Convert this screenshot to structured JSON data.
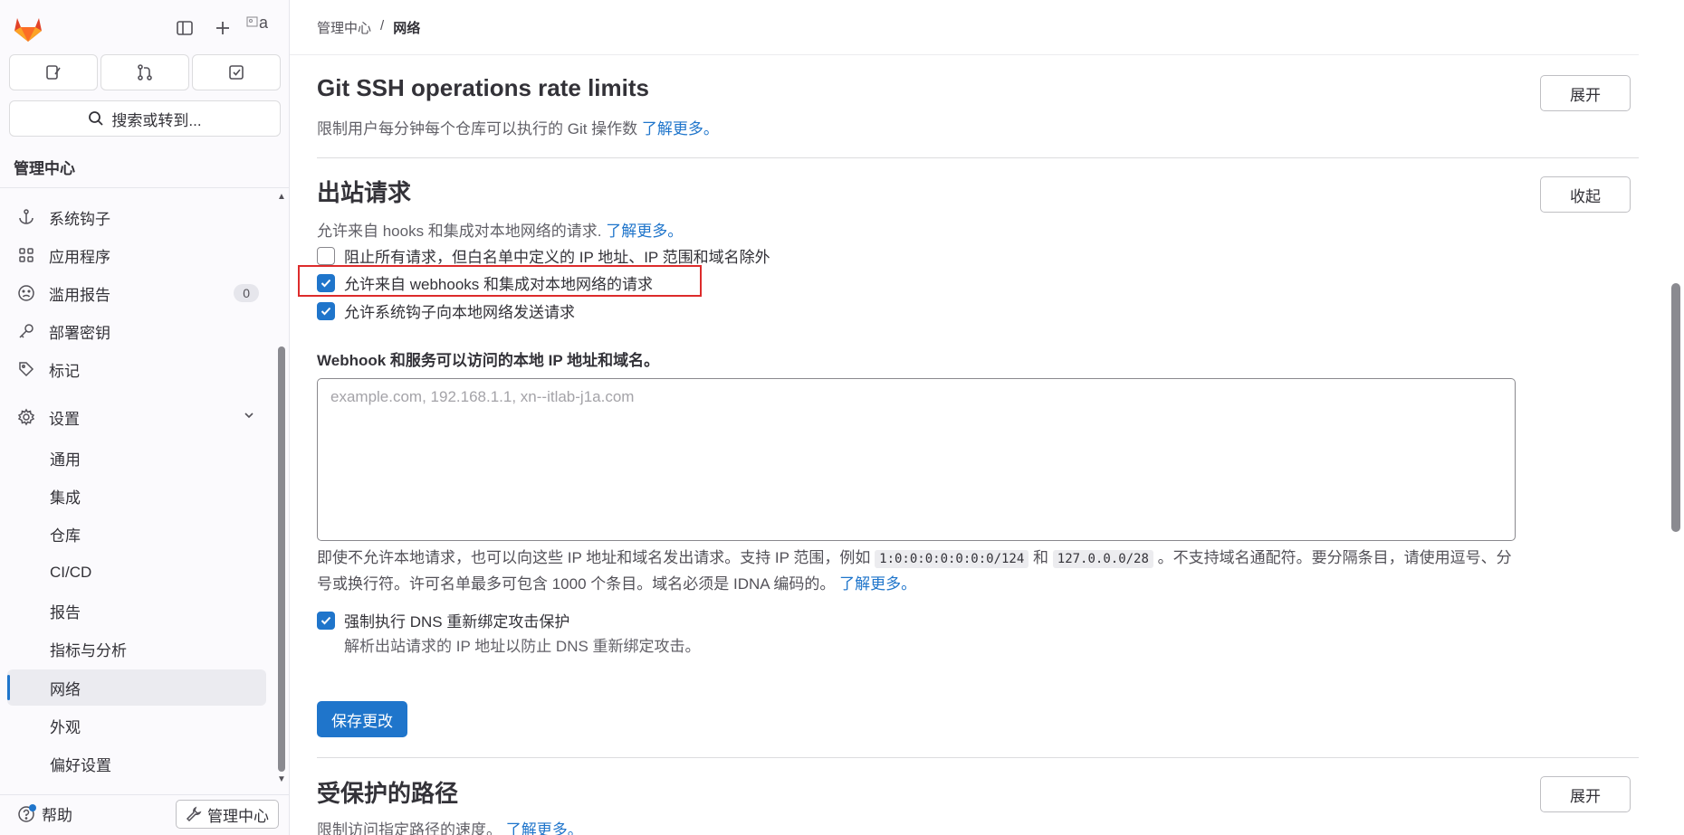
{
  "sidebar": {
    "search_label": "搜索或转到...",
    "section_title": "管理中心",
    "items": [
      {
        "label": "系统钩子",
        "icon": "hook-icon"
      },
      {
        "label": "应用程序",
        "icon": "applications-icon"
      },
      {
        "label": "滥用报告",
        "icon": "abuse-icon",
        "badge": "0"
      },
      {
        "label": "部署密钥",
        "icon": "key-icon"
      },
      {
        "label": "标记",
        "icon": "label-icon"
      },
      {
        "label": "设置",
        "icon": "settings-icon"
      }
    ],
    "sub_items": [
      {
        "label": "通用"
      },
      {
        "label": "集成"
      },
      {
        "label": "仓库"
      },
      {
        "label": "CI/CD"
      },
      {
        "label": "报告"
      },
      {
        "label": "指标与分析"
      },
      {
        "label": "网络",
        "active": true
      },
      {
        "label": "外观"
      },
      {
        "label": "偏好设置"
      }
    ],
    "help_label": "帮助",
    "admin_label": "管理中心",
    "avatar_alt": "a"
  },
  "breadcrumb": {
    "parent": "管理中心",
    "separator": "/",
    "current": "网络"
  },
  "sections": {
    "ssh": {
      "title": "Git SSH operations rate limits",
      "desc": "限制用户每分钟每个仓库可以执行的 Git 操作数",
      "link": "了解更多。",
      "button": "展开"
    },
    "outbound": {
      "title": "出站请求",
      "desc": "允许来自 hooks 和集成对本地网络的请求.",
      "link": "了解更多。",
      "button": "收起",
      "checkboxes": [
        {
          "label": "阻止所有请求，但白名单中定义的 IP 地址、IP 范围和域名除外",
          "checked": false
        },
        {
          "label": "允许来自 webhooks 和集成对本地网络的请求",
          "checked": true
        },
        {
          "label": "允许系统钩子向本地网络发送请求",
          "checked": true
        }
      ],
      "allowlist_label": "Webhook 和服务可以访问的本地 IP 地址和域名。",
      "allowlist_placeholder": "example.com, 192.168.1.1, xn--itlab-j1a.com",
      "allowlist_value": "",
      "help_part1": "即使不允许本地请求，也可以向这些 IP 地址和域名发出请求。支持 IP 范围，例如",
      "help_code1": "1:0:0:0:0:0:0:0/124",
      "help_and": "和",
      "help_code2": "127.0.0.0/28",
      "help_part2": "。不支持域名通配符。要分隔条目，请使用逗号、分号或换行符。许可名单最多可包含 1000 个条目。域名必须是 IDNA 编码的。",
      "help_link": "了解更多。",
      "dns_label": "强制执行 DNS 重新绑定攻击保护",
      "dns_checked": true,
      "dns_help": "解析出站请求的 IP 地址以防止 DNS 重新绑定攻击。",
      "save_button": "保存更改"
    },
    "protected": {
      "title": "受保护的路径",
      "desc": "限制访问指定路径的速度。",
      "link": "了解更多。",
      "button": "展开"
    }
  },
  "colors": {
    "accent": "#1f75cb",
    "highlight_border": "#dd2b2b",
    "logo_orange": "#fc6d26"
  }
}
